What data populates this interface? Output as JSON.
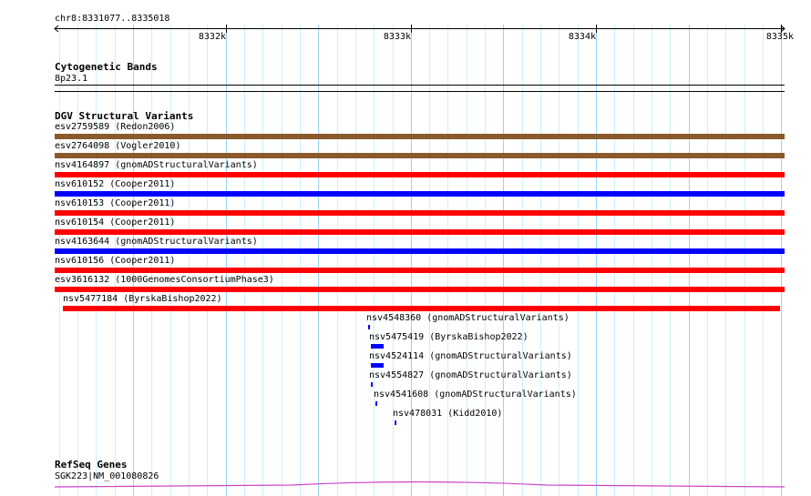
{
  "ruler": {
    "locus": "chr8:8331077..8335018",
    "ticks": [
      {
        "label": "8332k",
        "pos": 8332000
      },
      {
        "label": "8333k",
        "pos": 8333000
      },
      {
        "label": "8334k",
        "pos": 8334000
      },
      {
        "label": "8335k",
        "pos": 8335000
      }
    ]
  },
  "cytobands": {
    "title": "Cytogenetic Bands",
    "band": "8p23.1"
  },
  "dgv": {
    "title": "DGV Structural Variants",
    "variants": [
      {
        "label": "esv2759589 (Redon2006)",
        "start": 8331077,
        "end": 8335018,
        "color": "#8b5a2b"
      },
      {
        "label": "esv2764098 (Vogler2010)",
        "start": 8331077,
        "end": 8335018,
        "color": "#8b5a2b"
      },
      {
        "label": "nsv4164897 (gnomADStructuralVariants)",
        "start": 8331077,
        "end": 8335018,
        "color": "#ff0000"
      },
      {
        "label": "nsv610152 (Cooper2011)",
        "start": 8331077,
        "end": 8335018,
        "color": "#0000ff"
      },
      {
        "label": "nsv610153 (Cooper2011)",
        "start": 8331077,
        "end": 8335018,
        "color": "#ff0000"
      },
      {
        "label": "nsv610154 (Cooper2011)",
        "start": 8331077,
        "end": 8335018,
        "color": "#ff0000"
      },
      {
        "label": "nsv4163644 (gnomADStructuralVariants)",
        "start": 8331077,
        "end": 8335018,
        "color": "#0000ff"
      },
      {
        "label": "nsv610156 (Cooper2011)",
        "start": 8331077,
        "end": 8335018,
        "color": "#ff0000"
      },
      {
        "label": "esv3616132 (1000GenomesConsortiumPhase3)",
        "start": 8331077,
        "end": 8335018,
        "color": "#ff0000"
      },
      {
        "label": "nsv5477184 (ByrskaBishop2022)",
        "start": 8331120,
        "end": 8334995,
        "color": "#ff0000"
      },
      {
        "label": "nsv4548360 (gnomADStructuralVariants)",
        "start": 8332768,
        "end": 8332775,
        "color": "#0000ff"
      },
      {
        "label": "nsv5475419 (ByrskaBishop2022)",
        "start": 8332783,
        "end": 8332855,
        "color": "#0000ff"
      },
      {
        "label": "nsv4524114 (gnomADStructuralVariants)",
        "start": 8332783,
        "end": 8332855,
        "color": "#0000ff"
      },
      {
        "label": "nsv4554827 (gnomADStructuralVariants)",
        "start": 8332783,
        "end": 8332793,
        "color": "#0000ff"
      },
      {
        "label": "nsv4541608 (gnomADStructuralVariants)",
        "start": 8332808,
        "end": 8332818,
        "color": "#0000ff"
      },
      {
        "label": "nsv478031 (Kidd2010)",
        "start": 8332913,
        "end": 8332921,
        "color": "#0000ff"
      }
    ]
  },
  "refseq": {
    "title": "RefSeq Genes",
    "gene": "SGK223|NM_001080826",
    "color": "#cc44cc"
  }
}
